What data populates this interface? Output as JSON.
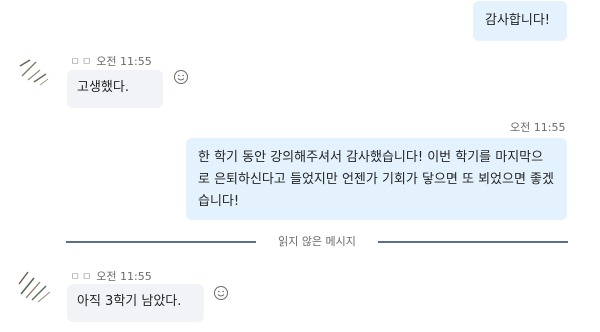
{
  "chat": {
    "messages": [
      {
        "direction": "out",
        "time": "",
        "text": "감사합니다!"
      },
      {
        "direction": "in",
        "sender": "ㅁ ㅁ",
        "time": "오전 11:55",
        "text": "고생했다."
      },
      {
        "direction": "out",
        "time": "오전 11:55",
        "text": "한 학기 동안 강의해주셔서 감사했습니다! 이번 학기를 마지막으로 은퇴하신다고 들었지만 언젠가 기회가 닿으면 또 뵈었으면 좋겠습니다!"
      },
      {
        "direction": "in",
        "sender": "ㅁ ㅁ",
        "time": "오전 11:55",
        "text": "아직 3학기 남았다."
      }
    ],
    "unread_divider": "읽지 않은 메시지"
  },
  "icons": {
    "reaction": "smile-icon",
    "avatar": "avatar-image"
  },
  "colors": {
    "outgoing_bubble": "#e3f2fc",
    "incoming_bubble": "#f1f3f6",
    "divider_line": "#5b6f8a"
  }
}
